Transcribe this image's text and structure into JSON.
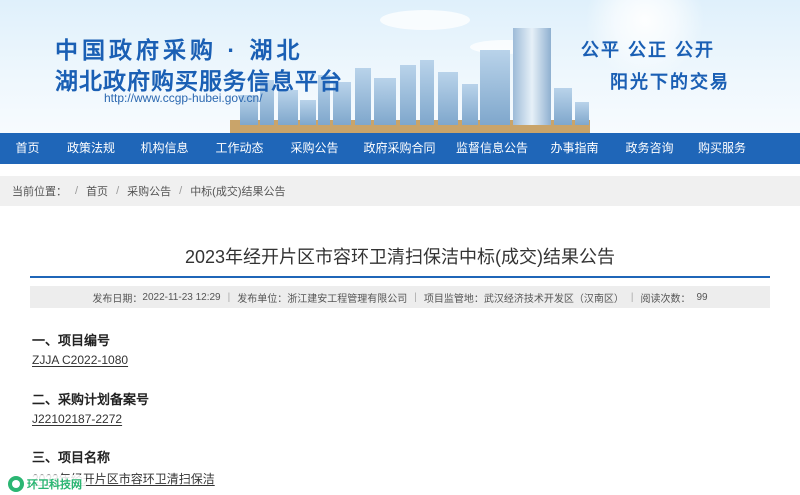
{
  "header": {
    "title_line1": "中国政府采购 · 湖北",
    "title_line2": "湖北政府购买服务信息平台",
    "url": "http://www.ccgp-hubei.gov.cn/",
    "slogan_line1": "公平  公正  公开",
    "slogan_line2": "阳光下的交易"
  },
  "nav": {
    "items": [
      {
        "label": "首页"
      },
      {
        "label": "政策法规"
      },
      {
        "label": "机构信息"
      },
      {
        "label": "工作动态"
      },
      {
        "label": "采购公告"
      },
      {
        "label": "政府采购合同"
      },
      {
        "label": "监督信息公告"
      },
      {
        "label": "办事指南"
      },
      {
        "label": "政务咨询"
      },
      {
        "label": "购买服务"
      }
    ]
  },
  "breadcrumb": {
    "prefix": "当前位置：",
    "items": [
      "首页",
      "采购公告",
      "中标(成交)结果公告"
    ]
  },
  "article": {
    "title": "2023年经开片区市容环卫清扫保洁中标(成交)结果公告",
    "meta": {
      "publish_date_label": "发布日期：",
      "publish_date": "2022-11-23 12:29",
      "publisher_label": "发布单位：",
      "publisher": "浙江建安工程管理有限公司",
      "region_label": "项目监管地：",
      "region": "武汉经济技术开发区（汉南区）",
      "views_label": "阅读次数：",
      "views": "99"
    },
    "sections": [
      {
        "heading": "一、项目编号",
        "value": "ZJJA C2022-1080"
      },
      {
        "heading": "二、采购计划备案号",
        "value": "J22102187-2272"
      },
      {
        "heading": "三、项目名称",
        "value": "2023年经开片区市容环卫清扫保洁"
      }
    ]
  },
  "watermark": {
    "text": "环卫科技网"
  },
  "colors": {
    "nav_bg": "#1f66b8",
    "brand_blue": "#1a5fb4"
  }
}
